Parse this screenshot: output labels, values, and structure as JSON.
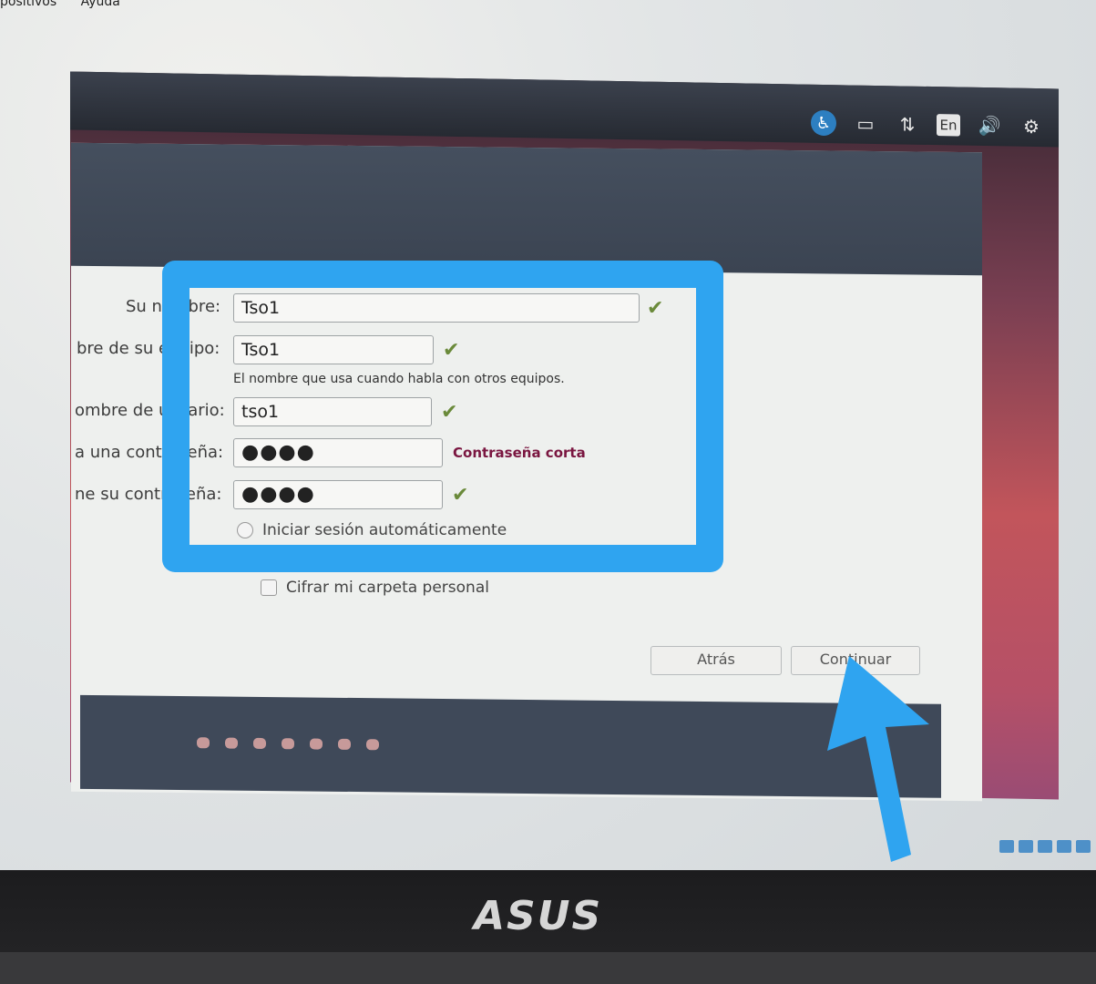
{
  "host_menu": {
    "items": [
      "positivos",
      "Ayuda"
    ]
  },
  "tray": {
    "accessibility_icon": "accessibility-icon",
    "battery_icon": "battery-icon",
    "network_icon": "network-arrows-icon",
    "language": "En",
    "volume_icon": "volume-icon",
    "settings_icon": "gear-icon"
  },
  "form": {
    "your_name": {
      "label": "Su nombre:",
      "value": "Tso1"
    },
    "computer_name": {
      "label": "bre de su equipo:",
      "value": "Tso1",
      "hint": "El nombre que usa cuando habla con otros equipos."
    },
    "username": {
      "label": "ombre de usuario:",
      "value": "tso1"
    },
    "password": {
      "label": "a una contraseña:",
      "value": "●●●●",
      "warning": "Contraseña corta"
    },
    "confirm_password": {
      "label": "ne su contraseña:",
      "value": "●●●●"
    },
    "autologin": {
      "label": "Iniciar sesión automáticamente"
    },
    "encrypt": {
      "label": "Cifrar mi carpeta personal"
    }
  },
  "buttons": {
    "back": "Atrás",
    "continue": "Continuar"
  },
  "progress": {
    "total_steps": 7
  },
  "bezel": {
    "brand": "ASUS"
  },
  "colors": {
    "highlight": "#2fa4f0",
    "warning": "#7a1640",
    "check": "#6a8a3a"
  }
}
